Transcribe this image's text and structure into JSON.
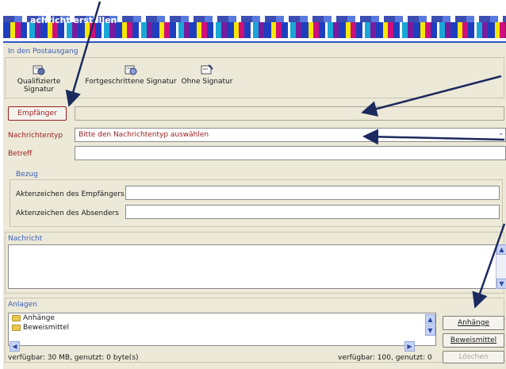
{
  "window": {
    "title_text": "achricht erstellen"
  },
  "postausgang": {
    "group_label": "In den Postausgang",
    "tools": [
      {
        "label": "Qualifizierte Signatur",
        "icon": "seal-signature-icon"
      },
      {
        "label": "Fortgeschrittene Signatur",
        "icon": "advanced-signature-icon"
      },
      {
        "label": "Ohne Signatur",
        "icon": "unsigned-letter-icon"
      }
    ]
  },
  "form": {
    "empfaenger_button": "Empfänger",
    "empfaenger_value": "",
    "nachrichtentyp_label": "Nachrichtentyp",
    "nachrichtentyp_value": "Bitte den Nachrichtentyp auswählen",
    "betreff_label": "Betreff",
    "betreff_value": ""
  },
  "bezug": {
    "group_label": "Bezug",
    "empfaenger_label": "Aktenzeichen des Empfängers",
    "empfaenger_value": "",
    "absender_label": "Aktenzeichen des Absenders",
    "absender_value": ""
  },
  "nachricht": {
    "group_label": "Nachricht",
    "text": ""
  },
  "anlagen": {
    "group_label": "Anlagen",
    "items": [
      "Anhänge",
      "Beweismittel"
    ],
    "anhaenge_button": "Anhänge",
    "beweismittel_button": "Beweismittel",
    "loeschen_button": "Löschen",
    "status_left": "verfügbar: 30 MB, genutzt: 0 byte(s)",
    "status_right": "verfügbar: 100, genutzt: 0"
  },
  "colors": {
    "accent_red": "#9a1c1c",
    "label_blue": "#3a5db8",
    "arrow_navy": "#1b2a5e"
  }
}
